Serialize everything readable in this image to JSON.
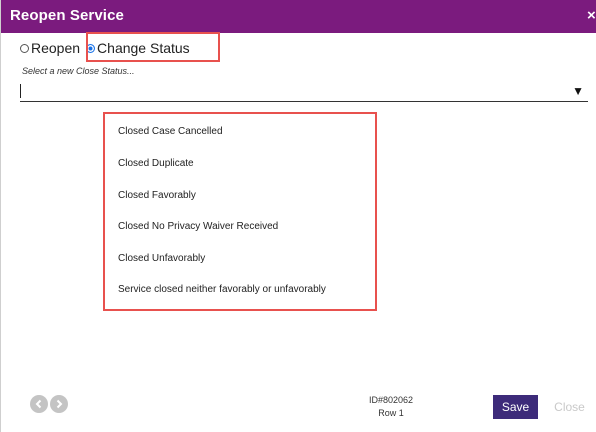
{
  "dialog": {
    "title": "Reopen Service",
    "close_glyph": "×"
  },
  "mode": {
    "options": [
      {
        "label": "Reopen",
        "checked": false
      },
      {
        "label": "Change Status",
        "checked": true
      }
    ]
  },
  "close_status": {
    "label": "Select a new Close Status...",
    "value": "",
    "arrow_glyph": "▼"
  },
  "dropdown": {
    "items": [
      "Closed Case Cancelled",
      "Closed Duplicate",
      "Closed Favorably",
      "Closed No Privacy Waiver Received",
      "Closed Unfavorably",
      "Service closed neither favorably or unfavorably"
    ]
  },
  "footer": {
    "record_id": "ID#802062",
    "row": "Row 1",
    "save_label": "Save",
    "close_label": "Close"
  },
  "colors": {
    "titlebar": "#7b1b7e",
    "save_button": "#3d2b7a",
    "highlight": "#e8514e",
    "radio_selected": "#1a73e8"
  },
  "icons": {
    "prev": "chevron-left-icon",
    "next": "chevron-right-icon",
    "close": "close-icon"
  }
}
